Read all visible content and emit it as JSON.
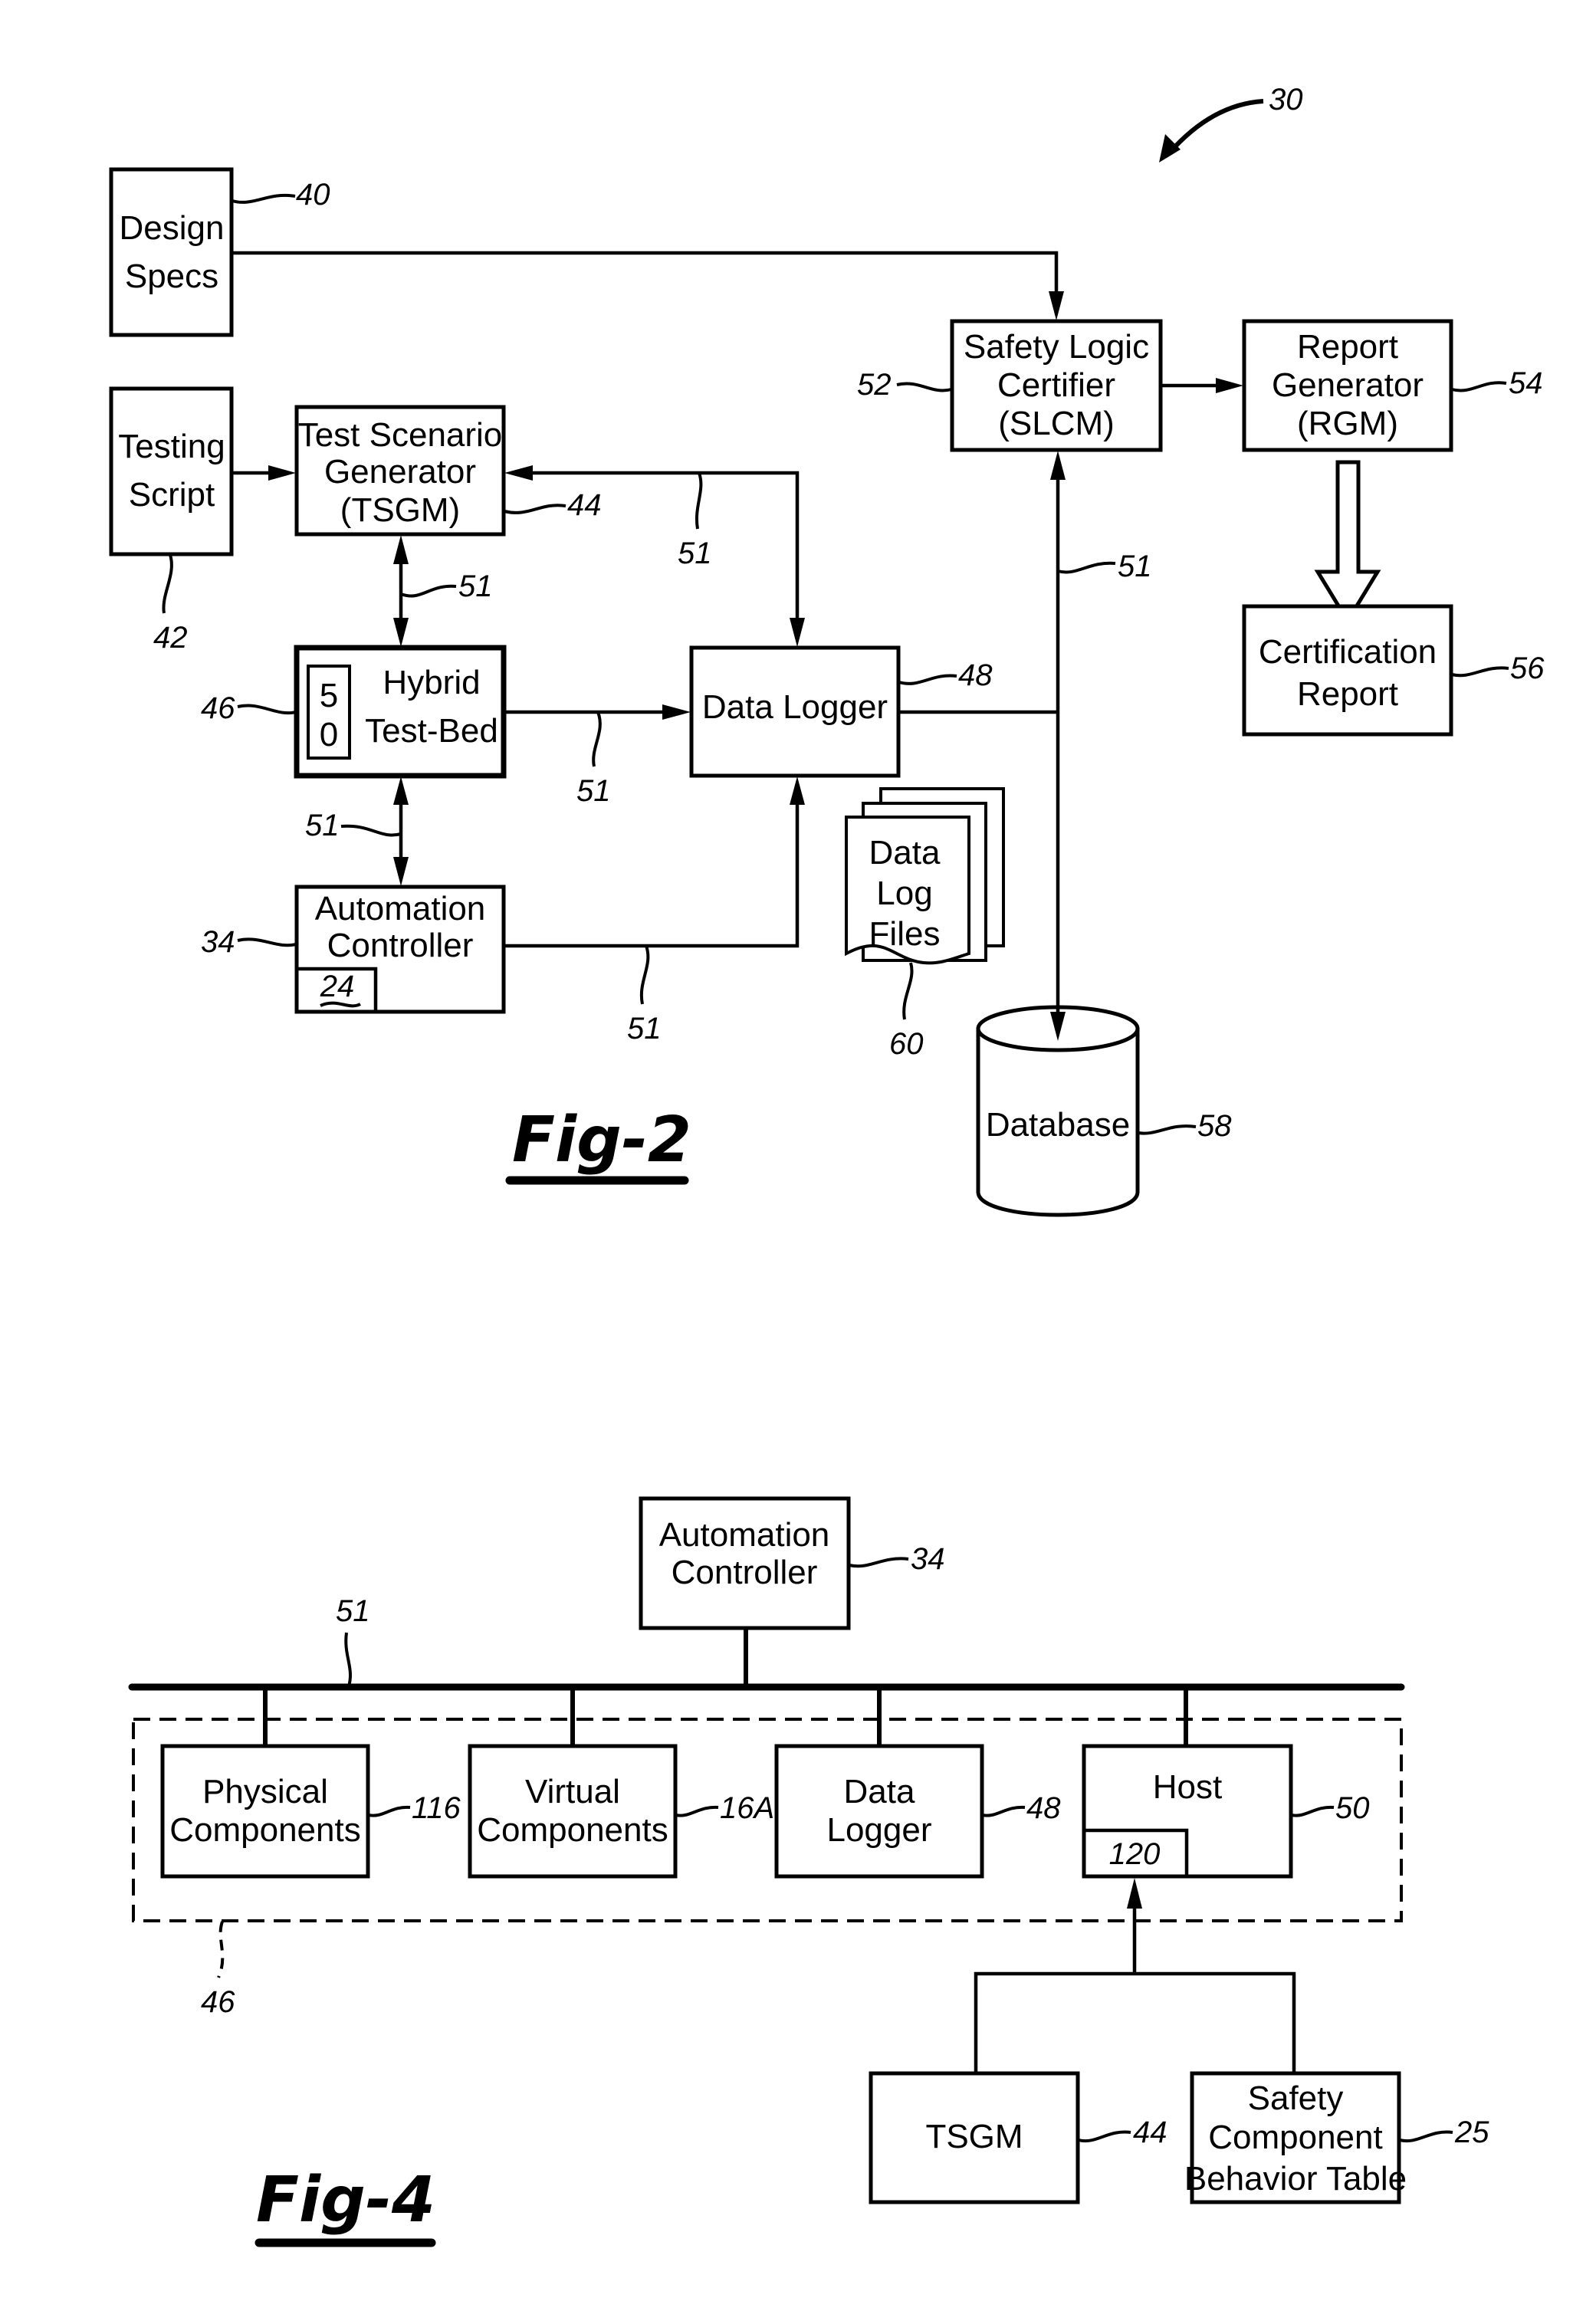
{
  "figure2": {
    "overall_ref": "30",
    "design_specs": {
      "lines": [
        "Design",
        "Specs"
      ],
      "ref": "40"
    },
    "testing_script": {
      "lines": [
        "Testing",
        "Script"
      ],
      "ref": "42"
    },
    "tsgm": {
      "lines": [
        "Test Scenario",
        "Generator",
        "(TSGM)"
      ],
      "ref": "44"
    },
    "hybrid_test_bed": {
      "lines": [
        "Hybrid",
        "Test-Bed"
      ],
      "ref": "46",
      "inner_box": [
        "5",
        "0"
      ]
    },
    "automation_controller": {
      "lines": [
        "Automation",
        "Controller"
      ],
      "ref": "34",
      "inner_ref": "24"
    },
    "data_logger": {
      "lines": [
        "Data Logger"
      ],
      "ref": "48"
    },
    "slcm": {
      "lines": [
        "Safety Logic",
        "Certifier",
        "(SLCM)"
      ],
      "ref": "52"
    },
    "rgm": {
      "lines": [
        "Report",
        "Generator",
        "(RGM)"
      ],
      "ref": "54"
    },
    "certification_report": {
      "lines": [
        "Certification",
        "Report"
      ],
      "ref": "56"
    },
    "database": {
      "lines": [
        "Database"
      ],
      "ref": "58"
    },
    "data_log_files": {
      "lines": [
        "Data",
        "Log",
        "Files"
      ],
      "ref": "60"
    },
    "link_ref": "51",
    "caption": "Fig-2"
  },
  "figure4": {
    "automation_controller": {
      "lines": [
        "Automation",
        "Controller"
      ],
      "ref": "34"
    },
    "bus_ref": "51",
    "hybrid_ref": "46",
    "physical_components": {
      "lines": [
        "Physical",
        "Components"
      ],
      "ref": "116"
    },
    "virtual_components": {
      "lines": [
        "Virtual",
        "Components"
      ],
      "ref": "16A"
    },
    "data_logger": {
      "lines": [
        "Data",
        "Logger"
      ],
      "ref": "48"
    },
    "host": {
      "lines": [
        "Host"
      ],
      "ref": "50",
      "inner_ref": "120"
    },
    "tsgm": {
      "lines": [
        "TSGM"
      ],
      "ref": "44"
    },
    "safety_table": {
      "lines": [
        "Safety",
        "Component",
        "Behavior Table"
      ],
      "ref": "25"
    },
    "caption": "Fig-4"
  }
}
